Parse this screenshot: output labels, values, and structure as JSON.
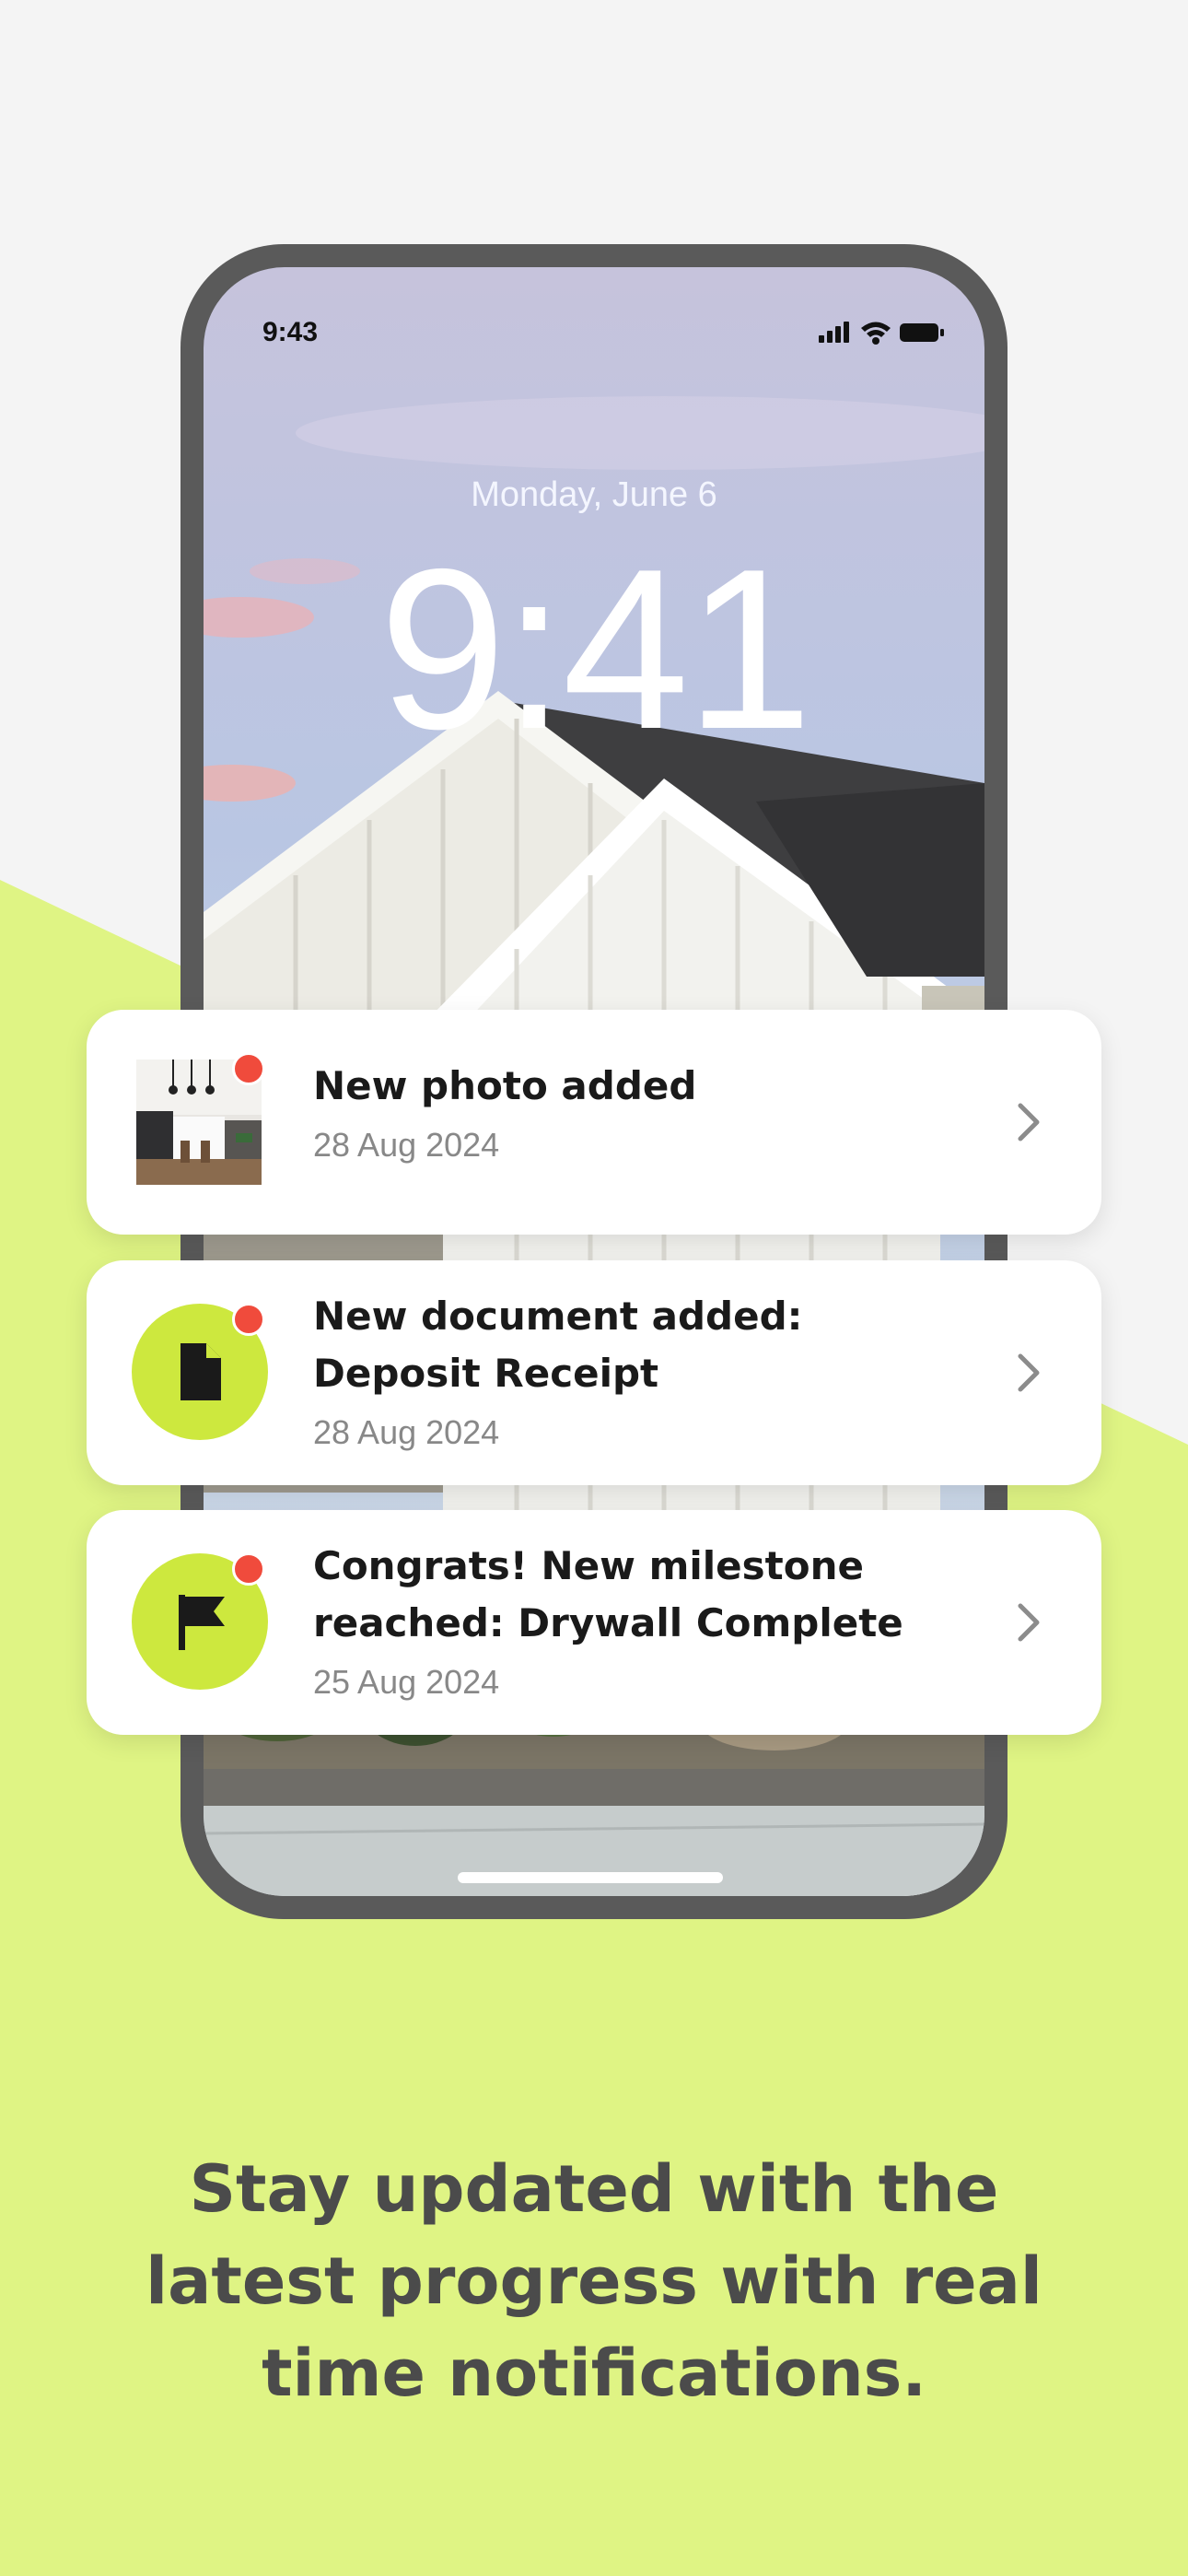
{
  "colors": {
    "background": "#f4f4f4",
    "accent_green": "#dff484",
    "icon_green": "#cde83e",
    "notification_dot": "#f04b3c"
  },
  "phone": {
    "status_bar": {
      "time": "9:43",
      "icons": [
        "cellular-signal-icon",
        "wifi-icon",
        "battery-icon"
      ]
    },
    "lock_screen": {
      "date": "Monday, June 6",
      "time": "9:41"
    }
  },
  "notifications": [
    {
      "icon": "kitchen-photo-thumbnail",
      "title": "New photo added",
      "date": "28 Aug 2024",
      "unread": true
    },
    {
      "icon": "document-icon",
      "title": "New document added: Deposit Receipt",
      "date": "28 Aug 2024",
      "unread": true
    },
    {
      "icon": "flag-icon",
      "title": "Congrats! New milestone reached: Drywall Complete",
      "date": "25 Aug 2024",
      "unread": true
    }
  ],
  "headline": "Stay updated with the latest progress with real time notifications."
}
